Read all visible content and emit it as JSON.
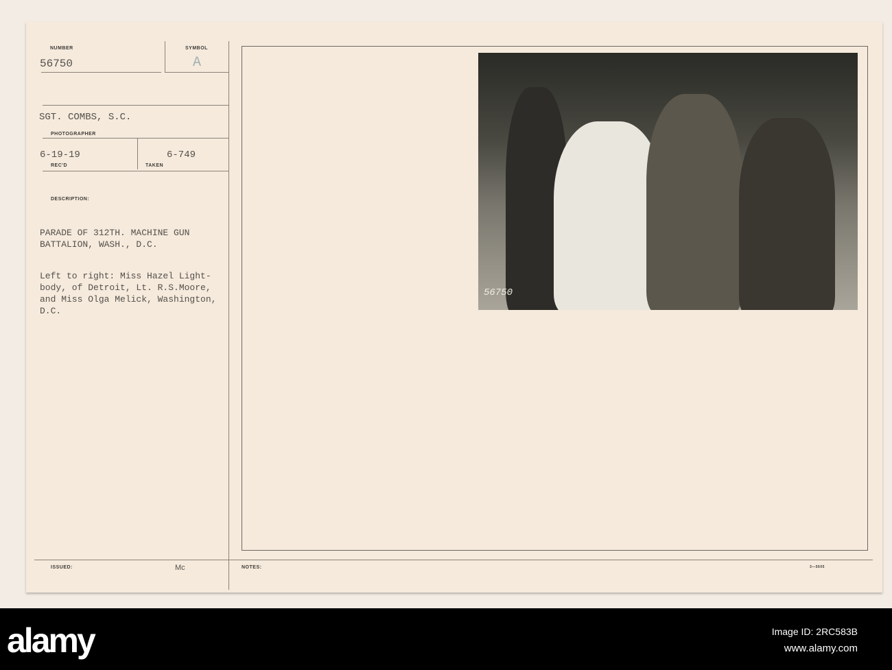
{
  "card": {
    "number_label": "NUMBER",
    "number": "56750",
    "symbol_label": "SYMBOL",
    "symbol": "A",
    "photographer": "SGT. COMBS, S.C.",
    "photographer_label": "PHOTOGRAPHER",
    "received": "6-19-19",
    "received_label": "REC'D",
    "taken_label": "TAKEN",
    "taken": "6-749",
    "description_label": "DESCRIPTION:",
    "description_lines": [
      "PARADE OF 312TH. MACHINE GUN",
      "BATTALION, WASH., D.C."
    ],
    "caption_lines": [
      "Left to right: Miss Hazel Light-",
      "body, of Detroit, Lt. R.S.Moore,",
      "and Miss Olga Melick, Washington,",
      "D.C."
    ],
    "issued_label": "ISSUED:",
    "issued_initials": "Mc",
    "notes_label": "NOTES:",
    "form_number": "3—5605",
    "photo_number": "56750"
  },
  "footer": {
    "logo": "alamy",
    "image_id": "Image ID: 2RC583B",
    "url": "www.alamy.com"
  }
}
